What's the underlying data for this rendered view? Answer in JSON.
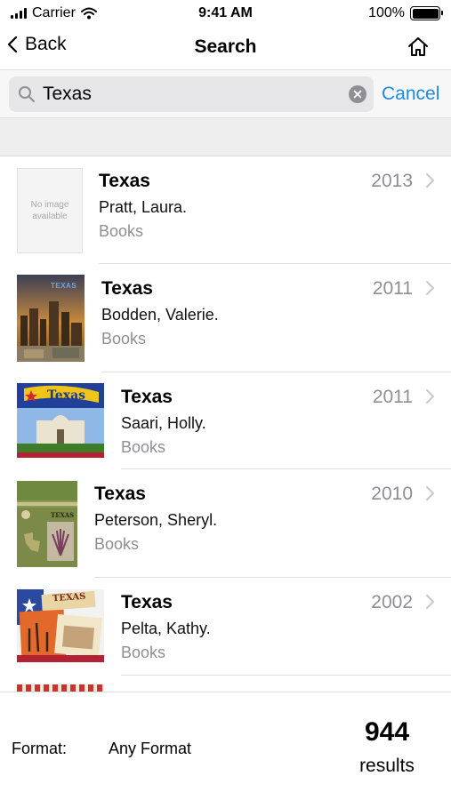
{
  "status_bar": {
    "carrier": "Carrier",
    "time": "9:41 AM",
    "battery": "100%"
  },
  "nav": {
    "back_label": "Back",
    "title": "Search"
  },
  "search": {
    "value": "Texas",
    "cancel_label": "Cancel"
  },
  "results": [
    {
      "title": "Texas",
      "author": "Pratt, Laura.",
      "format": "Books",
      "year": "2013",
      "cover": "no-image",
      "cover_text": "No image available"
    },
    {
      "title": "Texas",
      "author": "Bodden, Valerie.",
      "format": "Books",
      "year": "2011",
      "cover": "skyline",
      "cover_text": "TEXAS"
    },
    {
      "title": "Texas",
      "author": "Saari, Holly.",
      "format": "Books",
      "year": "2011",
      "cover": "alamo-flag",
      "cover_text": "Texas"
    },
    {
      "title": "Texas",
      "author": "Peterson, Sheryl.",
      "format": "Books",
      "year": "2010",
      "cover": "map-cactus",
      "cover_text": "TEXAS"
    },
    {
      "title": "Texas",
      "author": "Pelta, Kathy.",
      "format": "Books",
      "year": "2002",
      "cover": "postcard",
      "cover_text": "TEXAS"
    }
  ],
  "footer": {
    "format_label": "Format:",
    "format_value": "Any Format",
    "count": "944",
    "count_label": "results"
  },
  "colors": {
    "accent": "#1e88e5",
    "secondary_text": "#8e8e93"
  }
}
